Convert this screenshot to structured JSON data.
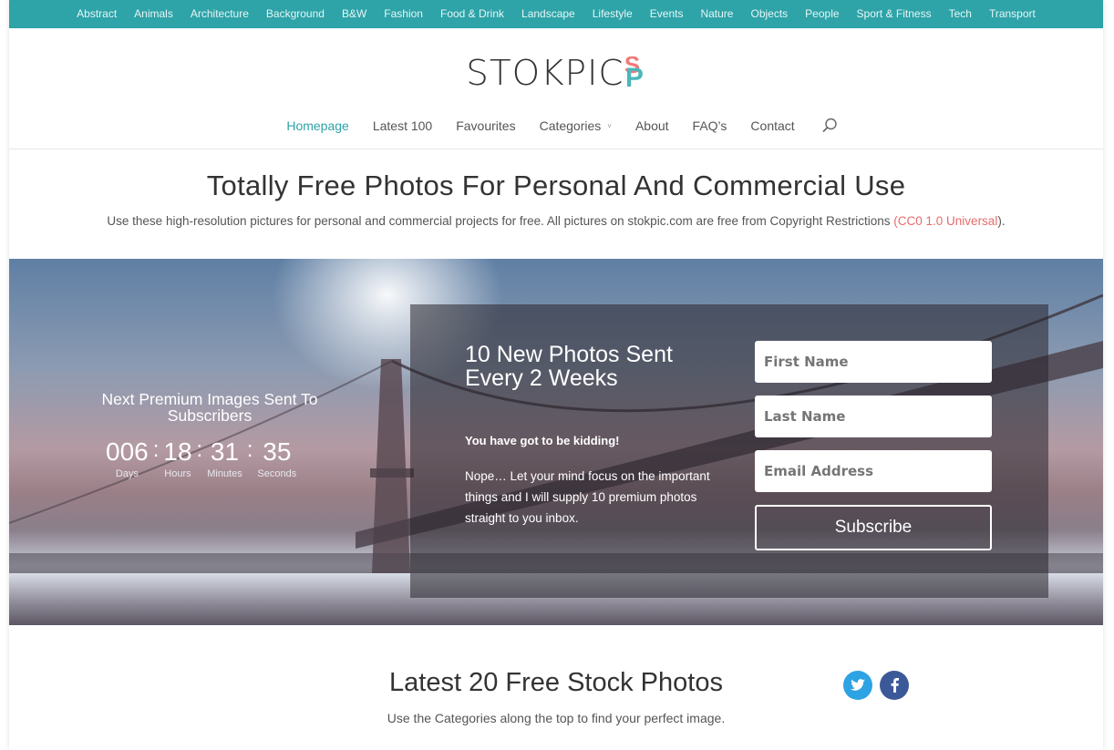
{
  "categories": [
    "Abstract",
    "Animals",
    "Architecture",
    "Background",
    "B&W",
    "Fashion",
    "Food & Drink",
    "Landscape",
    "Lifestyle",
    "Events",
    "Nature",
    "Objects",
    "People",
    "Sport & Fitness",
    "Tech",
    "Transport"
  ],
  "logo": {
    "text": "STOKPIC",
    "mark_top": "S",
    "mark_bottom": "P"
  },
  "nav": {
    "items": [
      "Homepage",
      "Latest 100",
      "Favourites",
      "Categories",
      "About",
      "FAQ’s",
      "Contact"
    ],
    "categories_chevron": "˅",
    "active": "Homepage"
  },
  "headline": "Totally Free Photos For Personal And Commercial Use",
  "subline": {
    "text": "Use these high-resolution pictures for personal and commercial projects for free. All pictures on stokpic.com are free from Copyright Restrictions ",
    "link": "(CC0 1.0 Universal",
    "end": ")."
  },
  "countdown": {
    "title": "Next Premium Images Sent To Subscribers",
    "days": "006",
    "hours": "18",
    "minutes": "31",
    "seconds": "35",
    "labels": {
      "days": "Days",
      "hours": "Hours",
      "minutes": "Minutes",
      "seconds": "Seconds"
    },
    "separator": ":"
  },
  "optin": {
    "title": "10 New Photos Sent Every 2 Weeks",
    "bold": "You have got to be kidding!",
    "desc": "Nope… Let your mind focus on the important things and I will supply 10 premium photos straight to you inbox.",
    "first_name": "First Name",
    "last_name": "Last Name",
    "email": "Email Address",
    "button": "Subscribe"
  },
  "latest": {
    "title": "Latest 20 Free Stock Photos",
    "sub": "Use the Categories along the top to find your perfect image."
  },
  "colors": {
    "accent": "#2ea3a8",
    "link_red": "#e86a6a",
    "twitter": "#2ea3e3",
    "facebook": "#3b5998"
  },
  "icons": {
    "search": "search-icon",
    "twitter": "twitter-icon",
    "facebook": "facebook-icon"
  }
}
